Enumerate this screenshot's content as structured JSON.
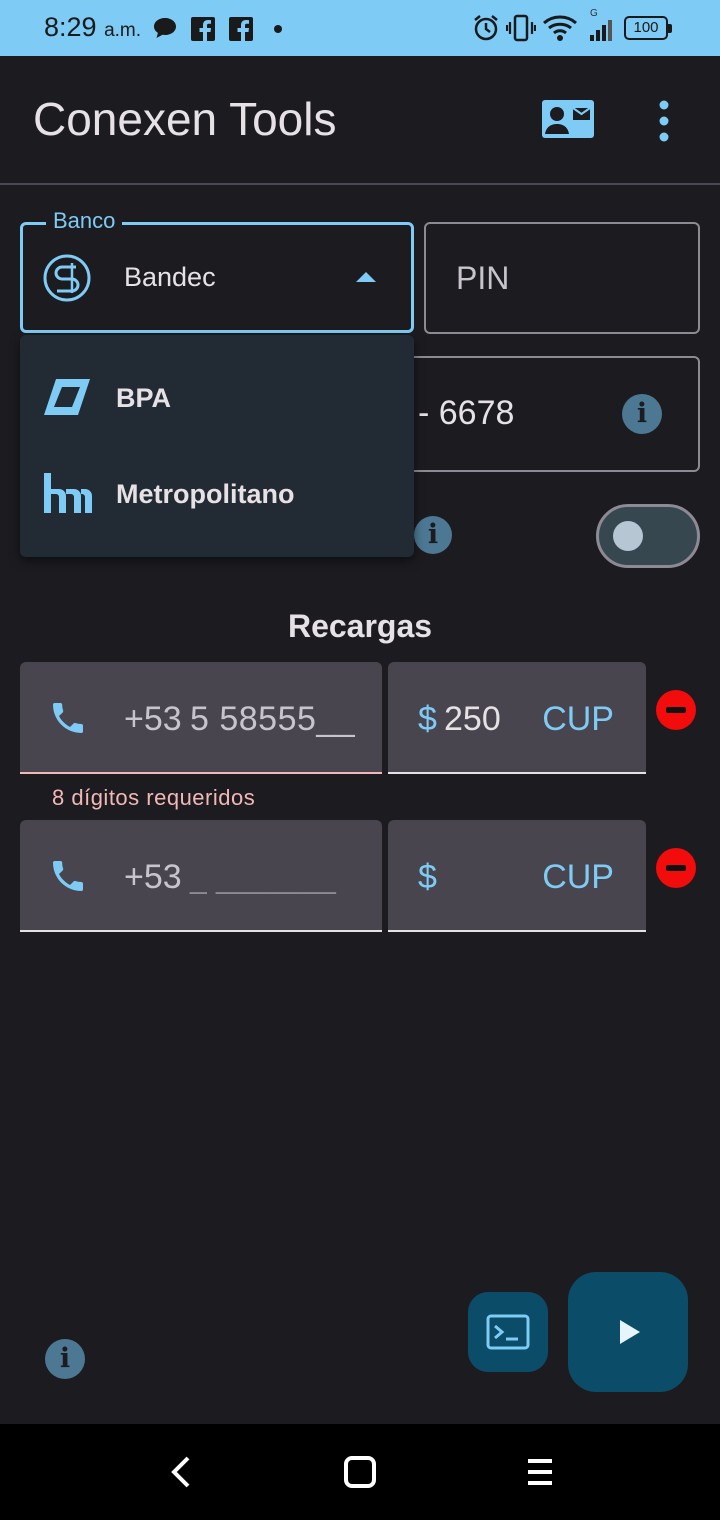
{
  "status_bar": {
    "time": "8:29",
    "ampm": "a.m.",
    "battery": "100",
    "network": "G"
  },
  "app_bar": {
    "title": "Conexen Tools",
    "actions": [
      "contact-mail-icon",
      "more-vert-icon"
    ]
  },
  "form": {
    "bank": {
      "label": "Banco",
      "value": "Bandec"
    },
    "pin": {
      "placeholder": "PIN"
    },
    "card": {
      "value": "- 6678"
    },
    "dropdown_options": [
      {
        "label": "BPA",
        "icon": "bpa-logo-icon"
      },
      {
        "label": "Metropolitano",
        "icon": "metropolitano-logo-icon"
      }
    ],
    "toggle": {
      "on": false
    }
  },
  "recharges": {
    "title": "Recargas",
    "rows": [
      {
        "prefix": "+53",
        "phone": "5 58555__",
        "currency_symbol": "$",
        "amount": "250",
        "currency": "CUP",
        "error": "8 dígitos requeridos"
      },
      {
        "prefix": "+53",
        "phone": "_ _______",
        "currency_symbol": "$",
        "amount": "",
        "currency": "CUP",
        "error": ""
      }
    ]
  },
  "colors": {
    "accent": "#7ecbf5",
    "background": "#1c1b20",
    "field_fill": "#49454f",
    "error": "#f2b8b5",
    "remove": "#f20c0c",
    "fab": "#0b4c68"
  }
}
